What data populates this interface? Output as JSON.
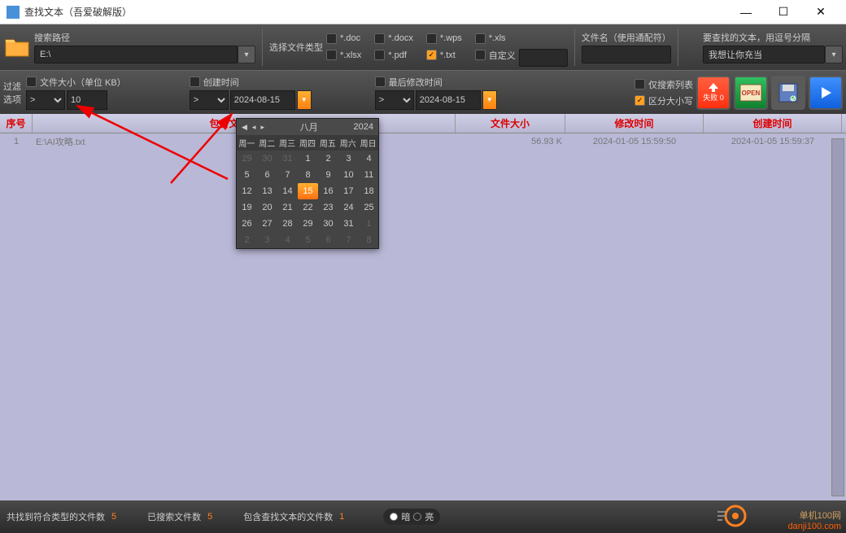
{
  "window": {
    "title": "查找文本（吾爱破解版）"
  },
  "toolbar1": {
    "path_label": "搜索路径",
    "path_value": "E:\\",
    "filetype_label": "选择文件类型",
    "filetypes": {
      "doc": "*.doc",
      "docx": "*.docx",
      "wps": "*.wps",
      "xls": "*.xls",
      "xlsx": "*.xlsx",
      "pdf": "*.pdf",
      "txt": "*.txt",
      "custom": "自定义"
    },
    "filename_label": "文件名（使用通配符）",
    "search_label": "要查找的文本，用逗号分隔",
    "search_value": "我想让你充当"
  },
  "toolbar2": {
    "filter_label": "过滤选项",
    "size_label": "文件大小（单位 KB）",
    "size_cmp": ">",
    "size_val": "10",
    "ctime_label": "创建时间",
    "ctime_cmp": ">",
    "ctime_val": "2024-08-15",
    "mtime_label": "最后修改时间",
    "mtime_cmp": ">",
    "mtime_val": "2024-08-15",
    "only_list": "仅搜索列表",
    "case_sensitive": "区分大小写",
    "fail_label": "失败 0"
  },
  "table": {
    "headers": {
      "seq": "序号",
      "file": "包含文本的文件",
      "size": "文件大小",
      "mtime": "修改时间",
      "ctime": "创建时间"
    },
    "rows": [
      {
        "seq": "1",
        "file": "E:\\AI攻略.txt",
        "size": "56.93 K",
        "mtime": "2024-01-05 15:59:50",
        "ctime": "2024-01-05 15:59:37"
      }
    ]
  },
  "calendar": {
    "month": "八月",
    "year": "2024",
    "weekdays": [
      "周一",
      "周二",
      "周三",
      "周四",
      "周五",
      "周六",
      "周日"
    ],
    "selected": 15,
    "days": [
      {
        "n": 29,
        "o": true
      },
      {
        "n": 30,
        "o": true
      },
      {
        "n": 31,
        "o": true
      },
      {
        "n": 1
      },
      {
        "n": 2
      },
      {
        "n": 3
      },
      {
        "n": 4
      },
      {
        "n": 5
      },
      {
        "n": 6
      },
      {
        "n": 7
      },
      {
        "n": 8
      },
      {
        "n": 9
      },
      {
        "n": 10
      },
      {
        "n": 11
      },
      {
        "n": 12
      },
      {
        "n": 13
      },
      {
        "n": 14
      },
      {
        "n": 15,
        "sel": true
      },
      {
        "n": 16
      },
      {
        "n": 17
      },
      {
        "n": 18
      },
      {
        "n": 19
      },
      {
        "n": 20
      },
      {
        "n": 21
      },
      {
        "n": 22
      },
      {
        "n": 23
      },
      {
        "n": 24
      },
      {
        "n": 25
      },
      {
        "n": 26
      },
      {
        "n": 27
      },
      {
        "n": 28
      },
      {
        "n": 29
      },
      {
        "n": 30
      },
      {
        "n": 31
      },
      {
        "n": 1,
        "o": true
      },
      {
        "n": 2,
        "o": true
      },
      {
        "n": 3,
        "o": true
      },
      {
        "n": 4,
        "o": true
      },
      {
        "n": 5,
        "o": true
      },
      {
        "n": 6,
        "o": true
      },
      {
        "n": 7,
        "o": true
      },
      {
        "n": 8,
        "o": true
      }
    ]
  },
  "status": {
    "found_label": "共找到符合类型的文件数",
    "found_num": "5",
    "searched_label": "已搜索文件数",
    "searched_num": "5",
    "contain_label": "包含查找文本的文件数",
    "contain_num": "1",
    "dark": "暗",
    "light": "亮"
  },
  "watermark": {
    "l1": "单机100网",
    "l2": "danji100.com"
  },
  "buttons": {
    "open": "OPEN"
  }
}
